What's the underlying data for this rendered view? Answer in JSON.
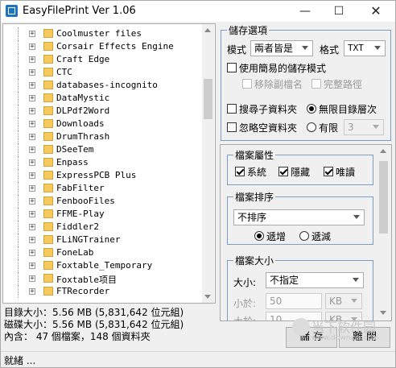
{
  "window": {
    "title": "EasyFilePrint Ver 1.06",
    "minimize": "—",
    "maximize": "☐",
    "close": "✕"
  },
  "tree": {
    "items": [
      "Coolmuster files",
      "Corsair Effects Engine",
      "Craft Edge",
      "CTC",
      "databases-incognito",
      "DataMystic",
      "DLPdf2Word",
      "Downloads",
      "DrumThrash",
      "DSeeTem",
      "Enpass",
      "ExpressPCB Plus",
      "FabFilter",
      "FenbooFiles",
      "FFME-Play",
      "Fiddler2",
      "FLiNGTrainer",
      "FoneLab",
      "Foxtable_Temporary",
      "Foxtable项目",
      "FTRecorder"
    ],
    "expander": "+"
  },
  "stats": {
    "dir_size_label": "目錄大小：",
    "dir_size_value": "5.56 MB (5,831,642 位元組)",
    "disk_size_label": "磁碟大小：",
    "disk_size_value": "5.56 MB (5,831,642 位元組)",
    "contains_label": "內含",
    "contains_value": "： 47 個檔案，148 個資料夾"
  },
  "save_options": {
    "title": "儲存選項",
    "mode_label": "模式",
    "mode_value": "兩者皆是",
    "format_label": "格式",
    "format_value": "TXT",
    "simple_mode_label": "使用簡易的儲存模式",
    "remove_ext_label": "移除副檔名",
    "full_path_label": "完整路徑",
    "search_sub_label": "搜尋子資料夾",
    "unlimited_label": "無限目錄層次",
    "ignore_empty_label": "忽略空資料夾",
    "limited_label": "有限",
    "limited_value": "3"
  },
  "file_attrs": {
    "title": "檔案屬性",
    "system_label": "系統",
    "hidden_label": "隱藏",
    "readonly_label": "唯讀"
  },
  "file_sort": {
    "title": "檔案排序",
    "sort_value": "不排序",
    "asc_label": "遞增",
    "desc_label": "遞減"
  },
  "file_size": {
    "title": "檔案大小",
    "size_label": "大小:",
    "size_value": "不指定",
    "less_label": "小於:",
    "less_value": "50",
    "less_unit": "KB",
    "greater_label": "大於:",
    "greater_value": "10",
    "greater_unit": "KB"
  },
  "buttons": {
    "save": "儲 存",
    "close": "離 開"
  },
  "status": {
    "text": "就緒 ..."
  },
  "watermark": {
    "text": "当下软件园",
    "url": "www.downxia.com"
  }
}
